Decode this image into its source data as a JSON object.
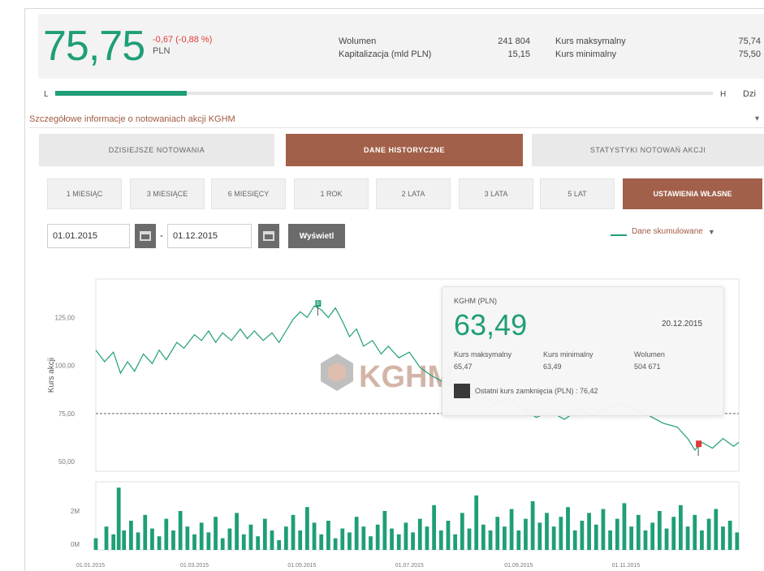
{
  "quote": {
    "price": "75,75",
    "change": "-0,67 (-0,88 %)",
    "currency": "PLN",
    "stats": [
      {
        "label": "Wolumen",
        "value": "241 804"
      },
      {
        "label": "Kapitalizacja (mld PLN)",
        "value": "15,15"
      },
      {
        "label": "Kurs maksymalny",
        "value": "75,74"
      },
      {
        "label": "Kurs minimalny",
        "value": "75,50"
      }
    ]
  },
  "range": {
    "low_label": "L",
    "high_label": "H",
    "today_label": "Dzi",
    "position": 0.2
  },
  "details": {
    "label": "Szczegółowe informacje o notowaniach akcji KGHM",
    "caret": "▾"
  },
  "main_tabs": [
    {
      "label": "DZISIEJSZE NOTOWANIA",
      "active": false
    },
    {
      "label": "DANE HISTORYCZNE",
      "active": true
    },
    {
      "label": "STATYSTYKI NOTOWAŃ AKCJI",
      "active": false
    }
  ],
  "periods": [
    {
      "label": "1 MIESIĄC",
      "active": false
    },
    {
      "label": "3 MIESIĄCE",
      "active": false
    },
    {
      "label": "6 MIESIĘCY",
      "active": false
    },
    {
      "label": "1 ROK",
      "active": false
    },
    {
      "label": "2 LATA",
      "active": false
    },
    {
      "label": "3 LATA",
      "active": false
    },
    {
      "label": "5 LAT",
      "active": false
    },
    {
      "label": "USTAWIENIA WŁASNE",
      "active": true
    }
  ],
  "date_from": "01.01.2015",
  "date_to": "01.12.2015",
  "date_sep": "-",
  "show_button": "Wyświetl",
  "data_toggle": "Dane skumulowane",
  "tooltip": {
    "company": "KGHM (PLN)",
    "price": "63,49",
    "date": "20.12.2015",
    "labels": [
      "Kurs maksymalny",
      "Kurs minimalny",
      "Wolumen"
    ],
    "values": [
      "65,47",
      "63,49",
      "504 671"
    ],
    "close_label": "Ostatni kurs zamknięcia (PLN) : 76,42"
  },
  "logo_text": "KGHM",
  "chart_data": {
    "type": "line",
    "ylabel": "Kurs akcji",
    "y_ticks": [
      "125,00",
      "100,00",
      "75,00",
      "50,00"
    ],
    "y_tick_values": [
      125,
      100,
      75,
      50
    ],
    "ylim": [
      45,
      145
    ],
    "x_ticks": [
      "01.01.2015",
      "01.03.2015",
      "01.05.2015",
      "01.07.2015",
      "01.09.2015",
      "01.11.2015"
    ],
    "x_tick_positions": [
      0,
      59,
      120,
      181,
      243,
      304
    ],
    "x_range": [
      0,
      365
    ],
    "reference_line": 75,
    "series": [
      {
        "values": [
          [
            0,
            108
          ],
          [
            5,
            102
          ],
          [
            10,
            107
          ],
          [
            14,
            96
          ],
          [
            18,
            102
          ],
          [
            22,
            97
          ],
          [
            27,
            106
          ],
          [
            32,
            101
          ],
          [
            36,
            108
          ],
          [
            40,
            103
          ],
          [
            46,
            112
          ],
          [
            50,
            109
          ],
          [
            56,
            116
          ],
          [
            60,
            113
          ],
          [
            64,
            118
          ],
          [
            68,
            112
          ],
          [
            72,
            117
          ],
          [
            77,
            113
          ],
          [
            82,
            119
          ],
          [
            86,
            114
          ],
          [
            90,
            118
          ],
          [
            95,
            113
          ],
          [
            100,
            117
          ],
          [
            104,
            112
          ],
          [
            108,
            118
          ],
          [
            112,
            124
          ],
          [
            116,
            128
          ],
          [
            120,
            125
          ],
          [
            124,
            131
          ],
          [
            128,
            129
          ],
          [
            132,
            125
          ],
          [
            136,
            130
          ],
          [
            140,
            123
          ],
          [
            144,
            115
          ],
          [
            148,
            119
          ],
          [
            152,
            110
          ],
          [
            157,
            113
          ],
          [
            162,
            106
          ],
          [
            166,
            110
          ],
          [
            172,
            104
          ],
          [
            178,
            107
          ],
          [
            184,
            99
          ],
          [
            190,
            95
          ],
          [
            196,
            92
          ],
          [
            202,
            90
          ],
          [
            210,
            84
          ],
          [
            218,
            86
          ],
          [
            226,
            80
          ],
          [
            234,
            83
          ],
          [
            242,
            78
          ],
          [
            250,
            73
          ],
          [
            258,
            76
          ],
          [
            266,
            72
          ],
          [
            274,
            77
          ],
          [
            282,
            74
          ],
          [
            290,
            78
          ],
          [
            298,
            80
          ],
          [
            306,
            77
          ],
          [
            314,
            74
          ],
          [
            322,
            70
          ],
          [
            330,
            68
          ],
          [
            336,
            62
          ],
          [
            340,
            56
          ],
          [
            344,
            60
          ],
          [
            350,
            57
          ],
          [
            356,
            62
          ],
          [
            362,
            58
          ],
          [
            365,
            60
          ]
        ]
      },
      {
        "name": "Wolumen",
        "values": [
          [
            0,
            0.6
          ],
          [
            6,
            1.2
          ],
          [
            10,
            0.8
          ],
          [
            13,
            3.2
          ],
          [
            16,
            1.0
          ],
          [
            20,
            1.5
          ],
          [
            24,
            0.9
          ],
          [
            28,
            1.8
          ],
          [
            32,
            1.1
          ],
          [
            36,
            0.7
          ],
          [
            40,
            1.6
          ],
          [
            44,
            1.0
          ],
          [
            48,
            2.0
          ],
          [
            52,
            1.2
          ],
          [
            56,
            0.8
          ],
          [
            60,
            1.4
          ],
          [
            64,
            0.9
          ],
          [
            68,
            1.7
          ],
          [
            72,
            0.6
          ],
          [
            76,
            1.1
          ],
          [
            80,
            1.9
          ],
          [
            84,
            0.8
          ],
          [
            88,
            1.3
          ],
          [
            92,
            0.7
          ],
          [
            96,
            1.6
          ],
          [
            100,
            1.0
          ],
          [
            104,
            0.5
          ],
          [
            108,
            1.2
          ],
          [
            112,
            1.8
          ],
          [
            116,
            1.0
          ],
          [
            120,
            2.2
          ],
          [
            124,
            1.4
          ],
          [
            128,
            0.8
          ],
          [
            132,
            1.5
          ],
          [
            136,
            0.6
          ],
          [
            140,
            1.1
          ],
          [
            144,
            0.9
          ],
          [
            148,
            1.7
          ],
          [
            152,
            1.2
          ],
          [
            156,
            0.7
          ],
          [
            160,
            1.3
          ],
          [
            164,
            2.0
          ],
          [
            168,
            1.1
          ],
          [
            172,
            0.8
          ],
          [
            176,
            1.4
          ],
          [
            180,
            0.9
          ],
          [
            184,
            1.6
          ],
          [
            188,
            1.2
          ],
          [
            192,
            2.3
          ],
          [
            196,
            1.0
          ],
          [
            200,
            1.5
          ],
          [
            204,
            0.8
          ],
          [
            208,
            1.9
          ],
          [
            212,
            1.1
          ],
          [
            216,
            2.8
          ],
          [
            220,
            1.3
          ],
          [
            224,
            1.0
          ],
          [
            228,
            1.7
          ],
          [
            232,
            1.2
          ],
          [
            236,
            2.1
          ],
          [
            240,
            1.0
          ],
          [
            244,
            1.6
          ],
          [
            248,
            2.5
          ],
          [
            252,
            1.4
          ],
          [
            256,
            1.9
          ],
          [
            260,
            1.2
          ],
          [
            264,
            1.7
          ],
          [
            268,
            2.2
          ],
          [
            272,
            1.0
          ],
          [
            276,
            1.5
          ],
          [
            280,
            1.9
          ],
          [
            284,
            1.3
          ],
          [
            288,
            2.1
          ],
          [
            292,
            1.0
          ],
          [
            296,
            1.6
          ],
          [
            300,
            2.4
          ],
          [
            304,
            1.2
          ],
          [
            308,
            1.8
          ],
          [
            312,
            1.0
          ],
          [
            316,
            1.4
          ],
          [
            320,
            2.0
          ],
          [
            324,
            1.1
          ],
          [
            328,
            1.7
          ],
          [
            332,
            2.3
          ],
          [
            336,
            1.2
          ],
          [
            340,
            1.8
          ],
          [
            344,
            1.0
          ],
          [
            348,
            1.6
          ],
          [
            352,
            2.1
          ],
          [
            356,
            1.2
          ],
          [
            360,
            1.5
          ],
          [
            364,
            0.9
          ]
        ]
      }
    ],
    "volume_ticks": [
      "2M",
      "0M"
    ],
    "volume_tick_values": [
      2,
      0
    ],
    "volume_ylim": [
      0,
      3.5
    ],
    "markers": [
      {
        "label": "B",
        "color": "#1f9e78",
        "x": 126,
        "y": 131
      },
      {
        "label": "",
        "color": "#e23a3a",
        "x": 342,
        "y": 58
      }
    ],
    "grid": false,
    "line_color": "#1f9e78"
  }
}
